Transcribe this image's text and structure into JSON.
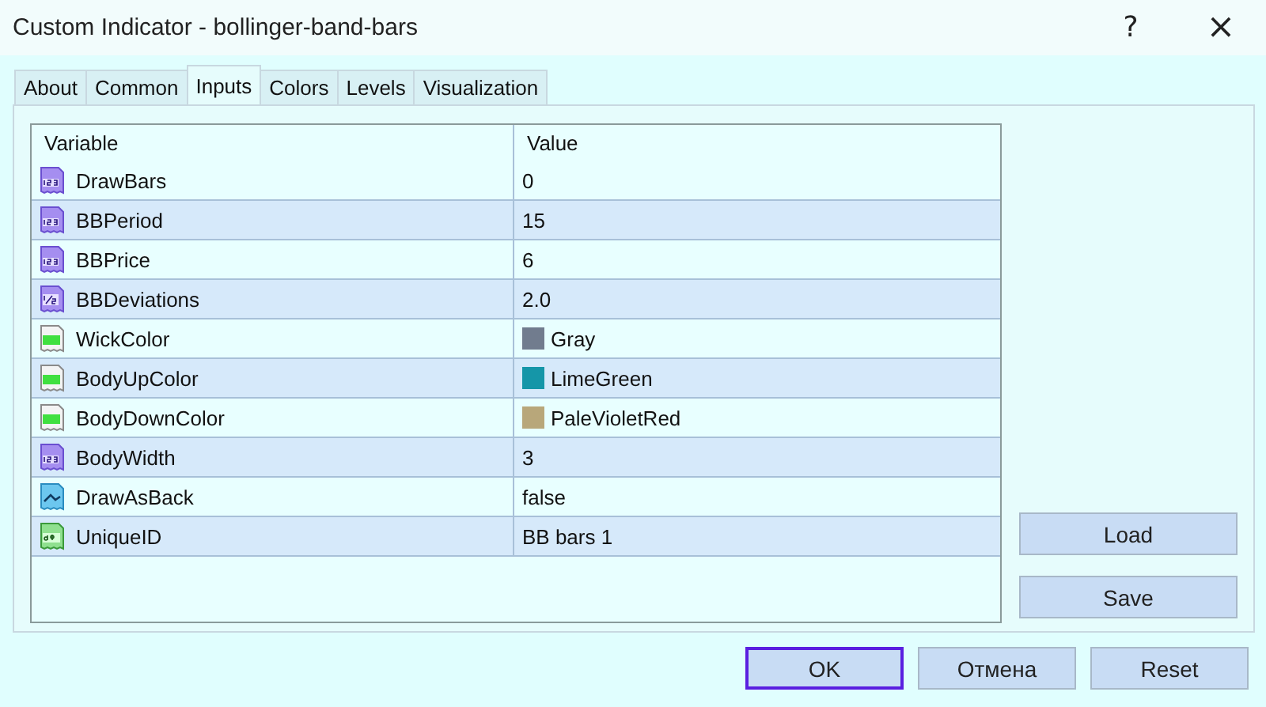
{
  "window": {
    "title": "Custom Indicator - bollinger-band-bars",
    "help": "?",
    "close": "×"
  },
  "tabs": [
    {
      "label": "About",
      "selected": false
    },
    {
      "label": "Common",
      "selected": false
    },
    {
      "label": "Inputs",
      "selected": true
    },
    {
      "label": "Colors",
      "selected": false
    },
    {
      "label": "Levels",
      "selected": false
    },
    {
      "label": "Visualization",
      "selected": false
    }
  ],
  "table": {
    "columns": [
      "Variable",
      "Value"
    ],
    "rows": [
      {
        "kind": "int",
        "variable": "DrawBars",
        "value": "0"
      },
      {
        "kind": "int",
        "variable": "BBPeriod",
        "value": "15"
      },
      {
        "kind": "int",
        "variable": "BBPrice",
        "value": "6"
      },
      {
        "kind": "double",
        "variable": "BBDeviations",
        "value": "2.0"
      },
      {
        "kind": "color",
        "variable": "WickColor",
        "value": "Gray",
        "color": "#717c8e"
      },
      {
        "kind": "color",
        "variable": "BodyUpColor",
        "value": "LimeGreen",
        "color": "#1596a8"
      },
      {
        "kind": "color",
        "variable": "BodyDownColor",
        "value": "PaleVioletRed",
        "color": "#b8a77a"
      },
      {
        "kind": "int",
        "variable": "BodyWidth",
        "value": "3"
      },
      {
        "kind": "bool",
        "variable": "DrawAsBack",
        "value": "false"
      },
      {
        "kind": "string",
        "variable": "UniqueID",
        "value": "BB bars 1"
      }
    ]
  },
  "side_buttons": [
    "Load",
    "Save"
  ],
  "buttons": [
    {
      "label": "OK",
      "focused": true
    },
    {
      "label": "Отмена",
      "focused": false
    },
    {
      "label": "Reset",
      "focused": false
    }
  ]
}
